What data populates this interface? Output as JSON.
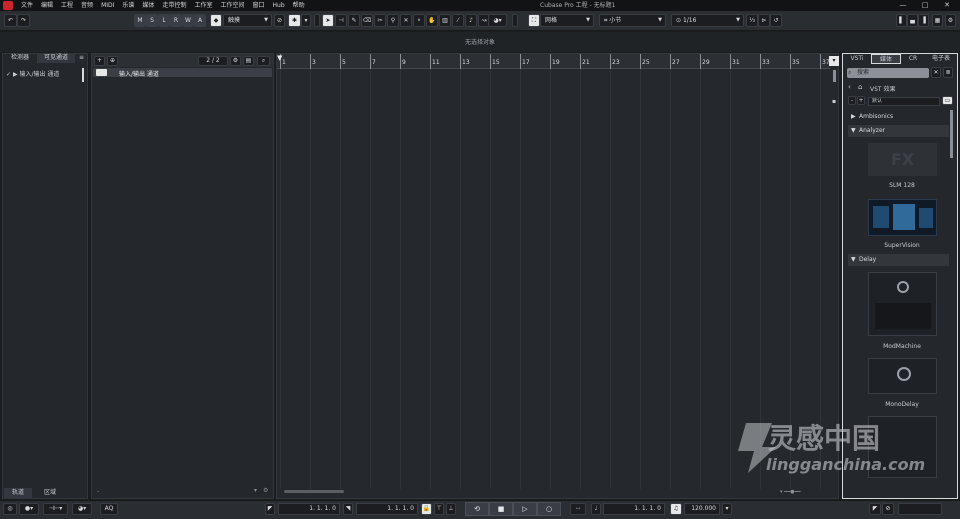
{
  "menu": [
    "文件",
    "编辑",
    "工程",
    "音频",
    "MIDI",
    "乐谱",
    "媒体",
    "走带控制",
    "工作室",
    "工作空间",
    "窗口",
    "Hub",
    "帮助"
  ],
  "window": {
    "title": "Cubase Pro 工程 - 无标题1",
    "minimize": "—",
    "maximize": "□",
    "close": "✕"
  },
  "toolbar": {
    "undo": "↶",
    "redo": "↷",
    "modes": [
      "M",
      "S",
      "L",
      "R",
      "W",
      "A"
    ],
    "automation_mode": "触摸",
    "snap_type": "网格",
    "grid": "小节",
    "quantize": "1/16",
    "quantize_label": "⊙"
  },
  "info_line": "无选择对象",
  "left_zone": {
    "tabs": [
      "检测器",
      "可见通道"
    ],
    "tree_item": "输入/输出 通道",
    "bottom_tabs": [
      "轨道",
      "区域"
    ]
  },
  "track_list": {
    "counter": "2 / 2",
    "track_name": "输入/输出 通道"
  },
  "ruler": {
    "bars": [
      "1",
      "3",
      "5",
      "7",
      "9",
      "11",
      "13",
      "15",
      "17",
      "19",
      "21",
      "23",
      "25",
      "27",
      "29",
      "31",
      "33",
      "35",
      "37"
    ]
  },
  "right_zone": {
    "tabs": [
      "VSTi",
      "媒体",
      "CR",
      "电子表"
    ],
    "search_placeholder": "搜索",
    "path": "VST 效果",
    "preset": "默认",
    "categories": [
      {
        "name": "Ambisonics",
        "open": false
      },
      {
        "name": "Analyzer",
        "open": true
      },
      {
        "name": "Delay",
        "open": true
      }
    ],
    "plugins": [
      "SLM 128",
      "SuperVision",
      "ModMachine",
      "MonoDelay"
    ]
  },
  "transport": {
    "left_locator": "1. 1. 1.  0",
    "right_locator": "1. 1. 1.  0",
    "position": "1. 1. 1.  0",
    "tempo": "120.000",
    "aq": "AQ"
  },
  "watermark": {
    "brand": "灵感中国",
    "url": "lingganchina.com"
  }
}
